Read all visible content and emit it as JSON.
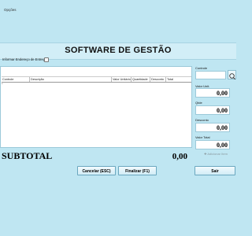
{
  "menubar": {
    "options_label": "Opções"
  },
  "app": {
    "title": "SOFTWARE DE GESTÃO"
  },
  "address": {
    "label": "Informar Endereço de Entrega"
  },
  "grid": {
    "columns": [
      "Controle",
      "Descrição",
      "Valor Unitário",
      "Quantidade",
      "Desconto",
      "Total"
    ],
    "cursor": "*"
  },
  "subtotal": {
    "label": "SUBTOTAL",
    "value": "0,00"
  },
  "side": {
    "control_label": "Controle",
    "unit_value_label": "Valor Unit.",
    "unit_value": "0,00",
    "qty_label": "Qtde",
    "qty": "0,00",
    "discount_label": "Desconto",
    "discount": "0,00",
    "total_label": "Valor Total",
    "total": "0,00",
    "add_item_label": "Adicionar Item"
  },
  "buttons": {
    "cancel": "Cancelar (ESC)",
    "finish": "Finalizar (F1)",
    "exit": "Sair"
  },
  "colors": {
    "background": "#bfe6f2",
    "panel": "#ffffff",
    "border": "#9cc9d9"
  }
}
